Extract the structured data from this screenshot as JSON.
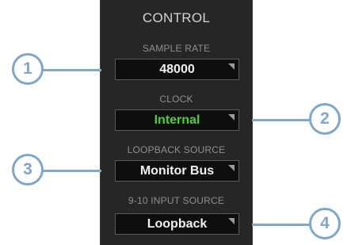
{
  "panel": {
    "title": "CONTROL",
    "sample_rate": {
      "label": "SAMPLE RATE",
      "value": "48000"
    },
    "clock": {
      "label": "CLOCK",
      "value": "Internal",
      "value_color": "#4cd137"
    },
    "loopback_source": {
      "label": "LOOPBACK SOURCE",
      "value": "Monitor Bus"
    },
    "input_source": {
      "label": "9-10 INPUT SOURCE",
      "value": "Loopback"
    }
  },
  "callouts": [
    "1",
    "2",
    "3",
    "4"
  ],
  "colors": {
    "panel_bg": "#262626",
    "callout": "#7ea6cf",
    "accent_green": "#4cd137"
  },
  "icons": [
    "dropdown-arrow-icon"
  ]
}
